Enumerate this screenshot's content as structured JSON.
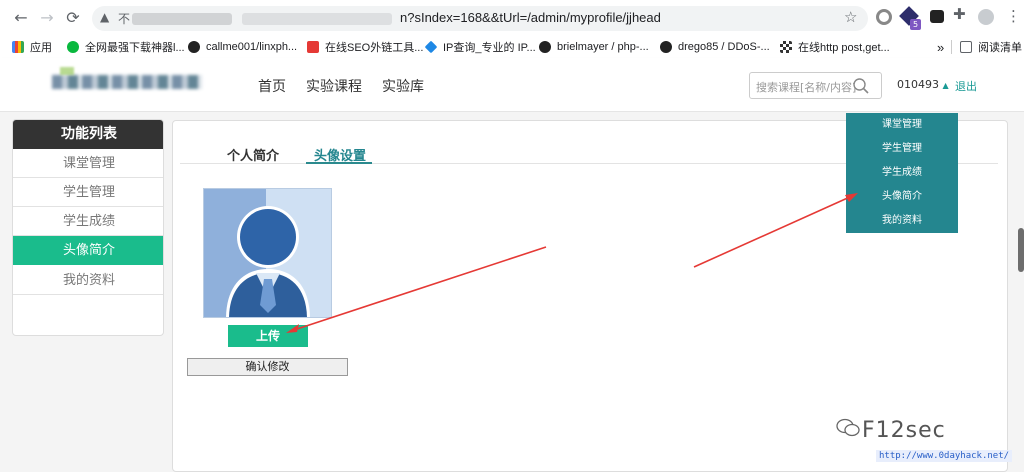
{
  "browser": {
    "url_prefix": "不",
    "url_tail": "n?sIndex=168&&tUrl=/admin/myprofile/jjhead",
    "bookmarks": [
      {
        "label": "应用",
        "icon": "apps-grid-icon"
      },
      {
        "label": "全网最强下载神器l...",
        "icon": "wechat-icon"
      },
      {
        "label": "callme001/linxph...",
        "icon": "github-icon"
      },
      {
        "label": "在线SEO外链工具...",
        "icon": "seo-tool-icon"
      },
      {
        "label": "IP查询_专业的 IP...",
        "icon": "ip-lookup-icon"
      },
      {
        "label": "brielmayer / php-...",
        "icon": "github-icon"
      },
      {
        "label": "drego85 / DDoS-...",
        "icon": "github-icon"
      },
      {
        "label": "在线http post,get...",
        "icon": "qr-tool-icon"
      }
    ],
    "more_bookmarks": "»",
    "reading_list": "阅读清单",
    "ext_badge": "5"
  },
  "header": {
    "nav": [
      "首页",
      "实验课程",
      "实验库"
    ],
    "search_placeholder": "搜索课程[名称/内容]",
    "user_id": "010493",
    "logout": "退出"
  },
  "sidebar": {
    "title": "功能列表",
    "items": [
      "课堂管理",
      "学生管理",
      "学生成绩",
      "头像简介",
      "我的资料"
    ],
    "active_index": 3
  },
  "profile": {
    "tabs": [
      "个人简介",
      "头像设置"
    ],
    "active_tab": 1,
    "upload_label": "上传",
    "confirm_label": "确认修改"
  },
  "dropdown": {
    "items": [
      "课堂管理",
      "学生管理",
      "学生成绩",
      "头像简介",
      "我的资料"
    ]
  },
  "watermark": {
    "text": "F12sec",
    "url": "http://www.0dayhack.net/"
  },
  "colors": {
    "accent": "#1abc8c",
    "dropdown_bg": "#24868f",
    "annotation_arrow": "#e53935"
  }
}
